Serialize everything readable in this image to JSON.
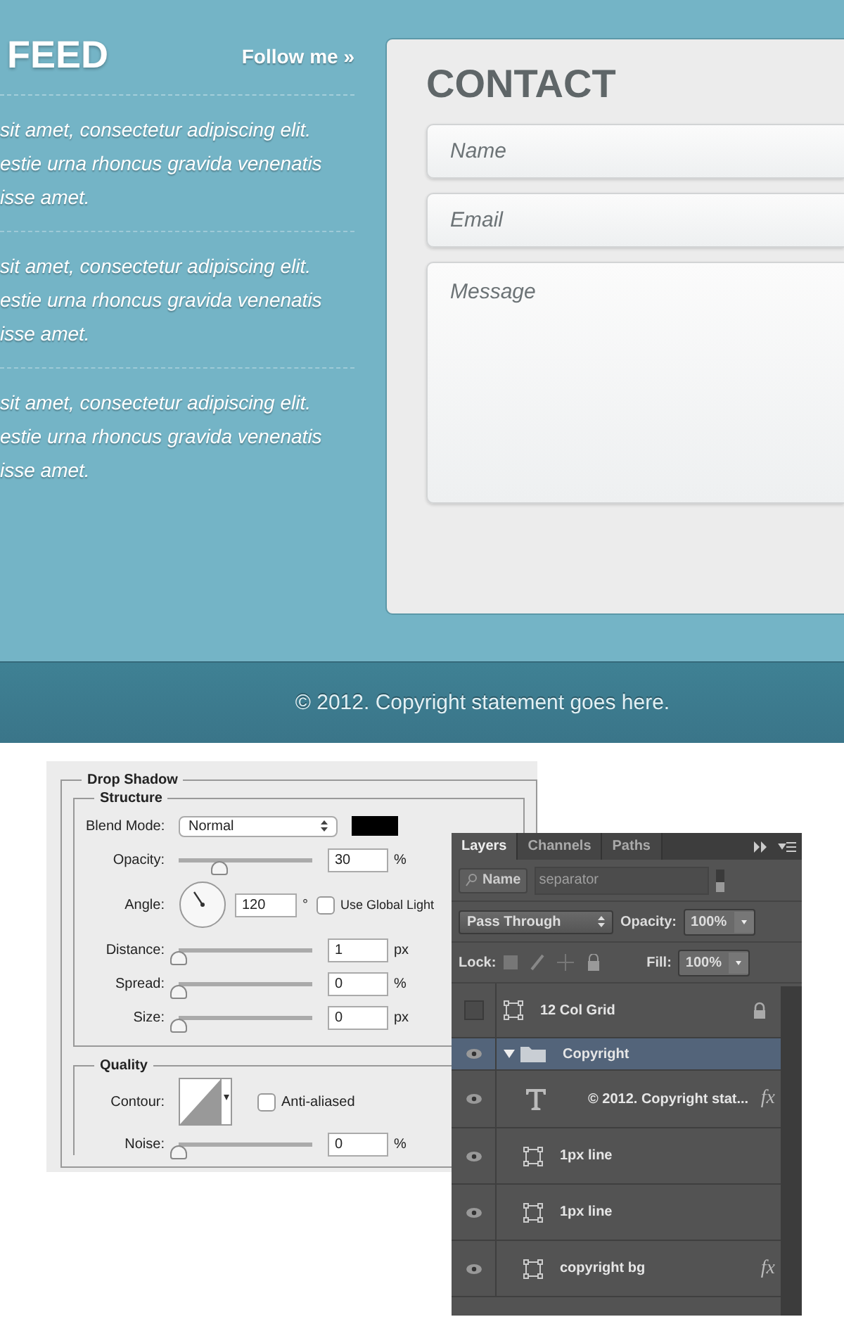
{
  "feed": {
    "title": "FEED",
    "follow": "Follow me »",
    "posts": [
      {
        "text": "sit amet, consectetur adipiscing elit.\nestie urna rhoncus gravida venenatis\nisse amet."
      },
      {
        "text": "sit amet, consectetur adipiscing elit.\nestie urna rhoncus gravida venenatis\nisse amet."
      },
      {
        "text": "sit amet, consectetur adipiscing elit.\nestie urna rhoncus gravida venenatis\nisse amet."
      }
    ]
  },
  "contact": {
    "title": "CONTACT",
    "fields": [
      {
        "kind": "input",
        "placeholder": "Name"
      },
      {
        "kind": "input",
        "placeholder": "Email"
      },
      {
        "kind": "textarea",
        "placeholder": "Message"
      }
    ]
  },
  "footer": {
    "text": "© 2012. Copyright statement goes here."
  },
  "drop_shadow": {
    "title": "Drop Shadow",
    "structure": {
      "title": "Structure",
      "blend_label": "Blend Mode:",
      "blend_mode": "Normal",
      "rows": [
        {
          "kind": "slider",
          "label": "Opacity:",
          "level": 0.3,
          "value": "30",
          "unit": "%"
        },
        {
          "kind": "angle",
          "label": "Angle:",
          "value": "120",
          "unit": "°",
          "checkbox": {
            "label": "Use Global Light",
            "checked": false
          }
        },
        {
          "kind": "slider",
          "label": "Distance:",
          "level": 0,
          "value": "1",
          "unit": "px"
        },
        {
          "kind": "slider",
          "label": "Spread:",
          "level": 0,
          "value": "0",
          "unit": "%"
        },
        {
          "kind": "slider",
          "label": "Size:",
          "level": 0,
          "value": "0",
          "unit": "px"
        }
      ]
    },
    "quality": {
      "title": "Quality",
      "contour_label": "Contour:",
      "anti_aliased": {
        "label": "Anti-aliased",
        "checked": false
      },
      "noise": {
        "label": "Noise:",
        "level": 0,
        "value": "0",
        "unit": "%"
      }
    }
  },
  "layers_panel": {
    "tabs": [
      {
        "label": "Layers",
        "selected": true
      },
      {
        "label": "Channels",
        "selected": false
      },
      {
        "label": "Paths",
        "selected": false
      }
    ],
    "filter": {
      "kind": "Name",
      "placeholder": "separator"
    },
    "blend_mode": "Pass Through",
    "opacity_label": "Opacity:",
    "opacity": "100%",
    "lock_label": "Lock:",
    "fill_label": "Fill:",
    "fill": "100%",
    "layers": [
      {
        "kind": "shape",
        "name": "12 Col Grid",
        "visible": false,
        "locked": true,
        "selected": false
      },
      {
        "kind": "group",
        "name": "Copyright",
        "visible": true,
        "expanded": true,
        "selected": true,
        "children": [
          {
            "kind": "text",
            "name": "© 2012. Copyright stat...",
            "visible": true,
            "badge": "fx",
            "selected": false
          },
          {
            "kind": "shape",
            "name": "1px line",
            "visible": true,
            "selected": false
          },
          {
            "kind": "shape",
            "name": "1px line",
            "visible": true,
            "selected": false
          },
          {
            "kind": "shape",
            "name": "copyright bg",
            "visible": true,
            "badge": "fx",
            "selected": false
          }
        ]
      }
    ]
  }
}
